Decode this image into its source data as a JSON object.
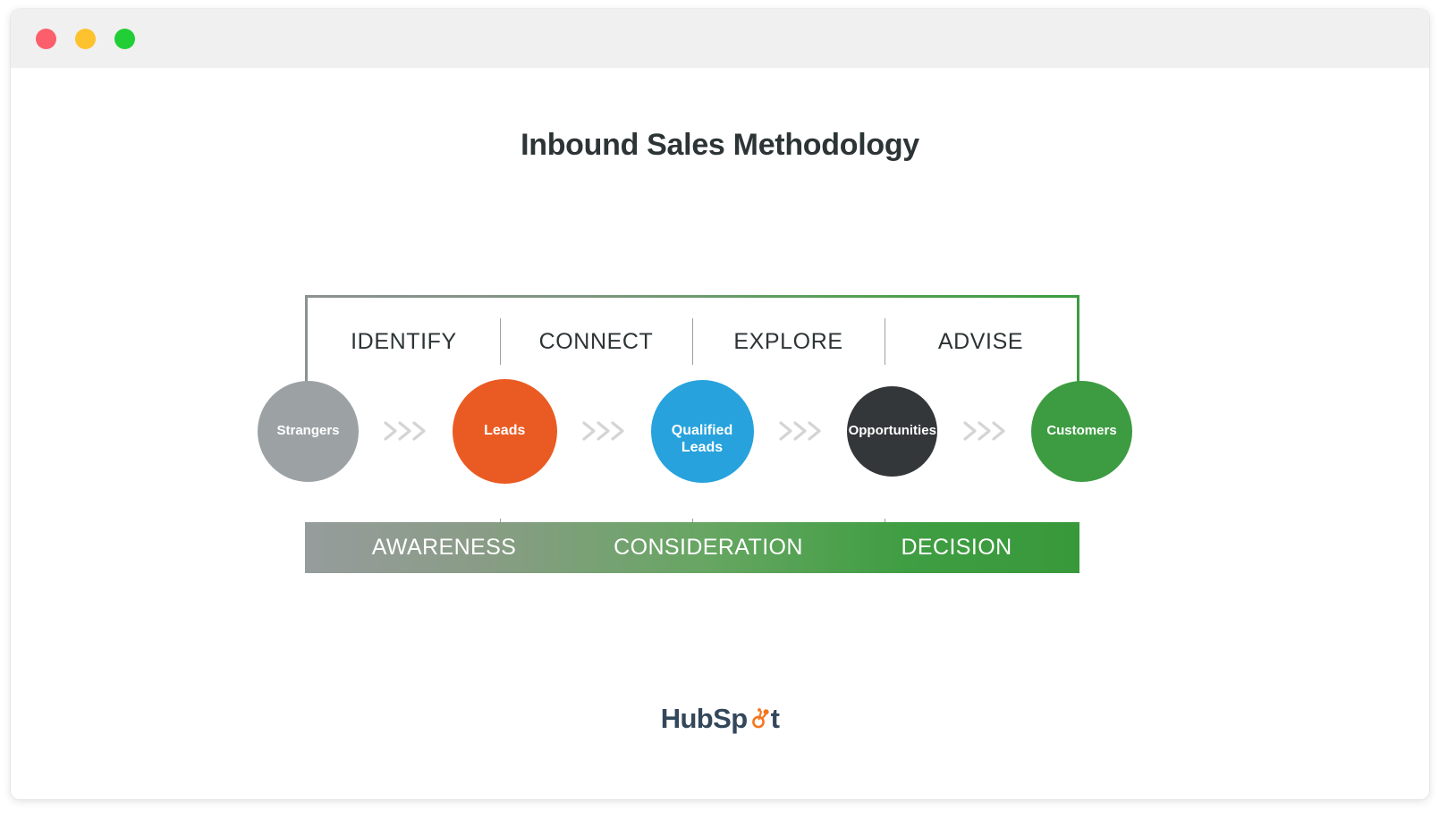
{
  "window": {
    "traffic_lights": [
      {
        "name": "close",
        "color": "#fc5e6b"
      },
      {
        "name": "minimize",
        "color": "#fdc22e"
      },
      {
        "name": "zoom",
        "color": "#21ce36"
      }
    ]
  },
  "header": {
    "title": "Inbound Sales Methodology"
  },
  "diagram": {
    "stages": [
      {
        "label": "IDENTIFY"
      },
      {
        "label": "CONNECT"
      },
      {
        "label": "EXPLORE"
      },
      {
        "label": "ADVISE"
      }
    ],
    "nodes": [
      {
        "label": "Strangers",
        "label_line2": "",
        "color": "#9ca2a4",
        "size": 113,
        "font_size": 15
      },
      {
        "label": "Leads",
        "label_line2": "",
        "color": "#ea5b24",
        "size": 117,
        "font_size": 16
      },
      {
        "label": "Qualified",
        "label_line2": "Leads",
        "color": "#27a2dd",
        "size": 115,
        "font_size": 16
      },
      {
        "label": "Opportunities",
        "label_line2": "",
        "color": "#333739",
        "size": 101,
        "font_size": 15
      },
      {
        "label": "Customers",
        "label_line2": "",
        "color": "#3d9c41",
        "size": 113,
        "font_size": 15
      }
    ],
    "connector_icon": "chevron-triple-right-icon",
    "connector_count": 4,
    "phases": [
      {
        "label": "AWARENESS"
      },
      {
        "label": "CONSIDERATION"
      },
      {
        "label": "DECISION"
      }
    ],
    "frame_start_color": "#8c9192",
    "frame_end_color": "#3d9c41"
  },
  "footer": {
    "brand_prefix": "HubSp",
    "brand_suffix": "t",
    "brand_icon": "hubspot-sprocket-icon",
    "brand_text_color": "#33475b",
    "brand_accent_color": "#f5761e"
  }
}
